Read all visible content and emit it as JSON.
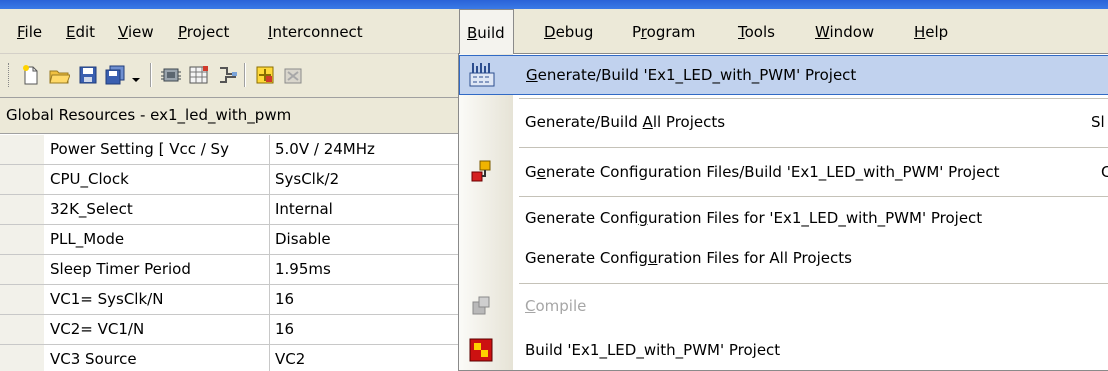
{
  "menubar": {
    "items": [
      {
        "label": "File",
        "ul": "F",
        "rest": "ile"
      },
      {
        "label": "Edit",
        "ul": "E",
        "rest": "dit"
      },
      {
        "label": "View",
        "ul": "V",
        "rest": "iew"
      },
      {
        "label": "Project",
        "ul": "P",
        "rest": "roject"
      },
      {
        "label": "Interconnect",
        "ul": "I",
        "rest": "nterconnect"
      },
      {
        "label": "Build",
        "ul": "B",
        "rest": "uild"
      },
      {
        "label": "Debug",
        "ul": "D",
        "rest": "ebug"
      },
      {
        "label": "Program",
        "pre": "P",
        "ul": "r",
        "rest": "ogram"
      },
      {
        "label": "Tools",
        "ul": "T",
        "rest": "ools"
      },
      {
        "label": "Window",
        "ul": "W",
        "rest": "indow"
      },
      {
        "label": "Help",
        "ul": "H",
        "rest": "elp"
      }
    ]
  },
  "toolbar": {
    "icons": [
      "new-file-icon",
      "open-folder-icon",
      "save-icon",
      "save-all-icon",
      "toolbar-dropdown-icon",
      "chip-editor-icon",
      "interconnect-view-icon",
      "wiring-icon",
      "place-module-icon",
      "delete-module-icon"
    ]
  },
  "panel": {
    "title": "Global Resources - ex1_led_with_pwm",
    "rows": [
      {
        "name": "Power Setting [ Vcc / Sy",
        "value": "5.0V / 24MHz"
      },
      {
        "name": "CPU_Clock",
        "value": "SysClk/2"
      },
      {
        "name": "32K_Select",
        "value": "Internal"
      },
      {
        "name": "PLL_Mode",
        "value": "Disable"
      },
      {
        "name": "Sleep Timer Period",
        "value": "1.95ms"
      },
      {
        "name": "VC1= SysClk/N",
        "value": "16"
      },
      {
        "name": "VC2= VC1/N",
        "value": "16"
      },
      {
        "name": "VC3 Source",
        "value": "VC2"
      }
    ]
  },
  "build_menu": {
    "items": [
      {
        "pre": "",
        "ul": "G",
        "post": "enerate/Build 'Ex1_LED_with_PWM' Project",
        "shortcut": "",
        "icon": "generate-build-icon"
      },
      {
        "pre": "Generate/Build ",
        "ul": "A",
        "post": "ll Projects",
        "shortcut": "Sl",
        "icon": ""
      },
      {
        "pre": "G",
        "ul": "e",
        "post": "nerate Configuration Files/Build 'Ex1_LED_with_PWM' Project",
        "shortcut": "C",
        "icon": "generate-config-build-icon"
      },
      {
        "pre": "Generate Confi",
        "ul": "g",
        "post": "uration Files for 'Ex1_LED_with_PWM' Project",
        "shortcut": "",
        "icon": ""
      },
      {
        "pre": "Generate Config",
        "ul": "u",
        "post": "ration Files for All Projects",
        "shortcut": "",
        "icon": ""
      },
      {
        "pre": "",
        "ul": "C",
        "post": "ompile",
        "shortcut": "",
        "icon": "compile-icon"
      },
      {
        "pre": "Build 'Ex1_LED_with_PWM' Project",
        "ul": "",
        "post": "",
        "shortcut": "",
        "icon": "build-project-icon"
      }
    ]
  },
  "colors": {
    "highlight": "#c1d2ee",
    "highlight_border": "#316ac5",
    "menubar_bg": "#ece9d8",
    "disabled_text": "#a6a6a6"
  }
}
